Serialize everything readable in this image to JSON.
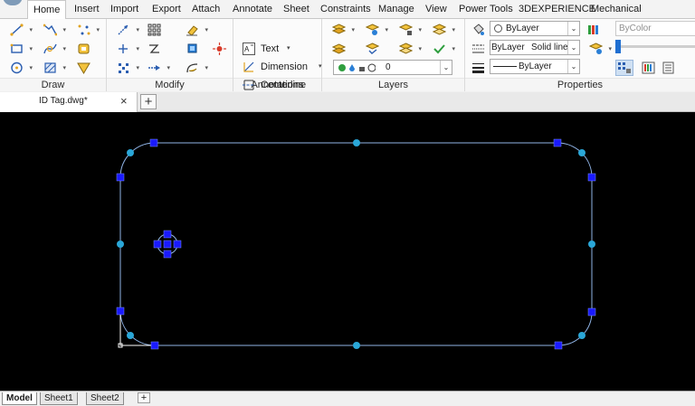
{
  "menu": {
    "tabs": [
      "Home",
      "Insert",
      "Import",
      "Export",
      "Attach",
      "Annotate",
      "Sheet",
      "Constraints",
      "Manage",
      "View",
      "Power Tools",
      "3DEXPERIENCE",
      "Mechanical"
    ],
    "active": "Home"
  },
  "ribbon": {
    "panels": {
      "draw": "Draw",
      "modify": "Modify",
      "annotations": "Annotations",
      "layers": "Layers",
      "properties": "Properties"
    },
    "annotations": {
      "text": "Text",
      "dimension": "Dimension",
      "centerline": "Centerline"
    },
    "layers": {
      "current_layer": "0",
      "state_icons": [
        "on-icon",
        "freeze-icon",
        "lock-icon"
      ]
    },
    "properties": {
      "color": "ByLayer",
      "linetype": "ByLayer",
      "linetype_style": "Solid line",
      "lineweight": "ByLayer",
      "plot_style": "ByColor"
    }
  },
  "document": {
    "tab_label": "ID Tag.dwg*",
    "close_glyph": "×",
    "new_tab_glyph": "+"
  },
  "layouts": {
    "tabs": [
      "Model",
      "Sheet1",
      "Sheet2"
    ],
    "active": "Model",
    "add_glyph": "+"
  },
  "colors": {
    "canvas_bg": "#000000",
    "geometry": "#8fb3e6",
    "grip_square": "#1a1aff",
    "grip_circle": "#2aa7d8",
    "accent": "#1f6fd1"
  }
}
